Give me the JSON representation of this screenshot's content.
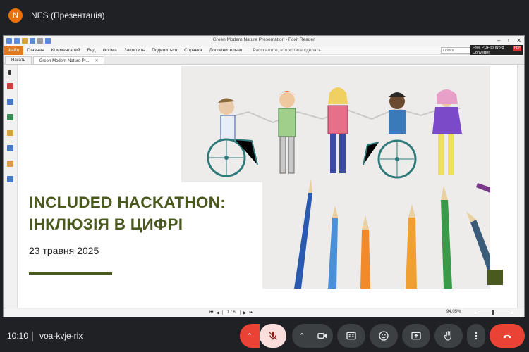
{
  "meeting": {
    "avatar_letter": "N",
    "presenter_label": "NES (Презентація)",
    "time": "10:10",
    "meeting_code": "voa-kvje-rix"
  },
  "app": {
    "window_title": "Green Modern Nature Presentation - Foxit Reader",
    "file_tab": "Файл",
    "menu_items": [
      "Главная",
      "Комментарий",
      "Вид",
      "Форма",
      "Защитить",
      "Поделиться",
      "Справка",
      "Дополнительно"
    ],
    "tell_me": "Расскажите, что хотите сделать",
    "search_placeholder": "Поиск",
    "promo_line1": "Free PDF to Word",
    "promo_line2": "Converter",
    "promo_badge": "PDF",
    "tabs": [
      "Начать",
      "Green Modern Nature Pr..."
    ],
    "page_indicator": "1 / 6",
    "zoom_level": "94,05%"
  },
  "slide": {
    "title_line1": "INCLUDED HACKATHON:",
    "title_line2": "ІНКЛЮЗІЯ В ЦИФРІ",
    "date": "23 травня 2025",
    "accent_color": "#4a5a1e"
  },
  "icons": [
    "camera-icon",
    "captions-icon",
    "emoji-icon",
    "present-icon",
    "raise-hand-icon",
    "more-icon",
    "end-call-icon",
    "mic-off-icon"
  ]
}
